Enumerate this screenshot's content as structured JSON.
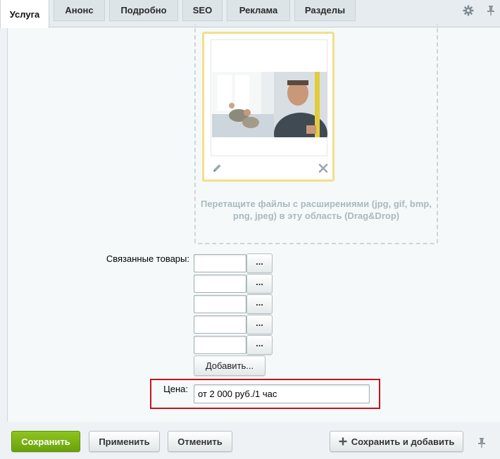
{
  "tabs": [
    {
      "label": "Услуга",
      "active": true
    },
    {
      "label": "Анонс",
      "active": false
    },
    {
      "label": "Подробно",
      "active": false
    },
    {
      "label": "SEO",
      "active": false
    },
    {
      "label": "Реклама",
      "active": false
    },
    {
      "label": "Разделы",
      "active": false
    }
  ],
  "toolbar_icons": [
    "gear-icon",
    "pin-icon"
  ],
  "image_upload": {
    "drop_hint": "Перетащите файлы с расширениями (jpg, gif, bmp, png, jpeg) в эту область (Drag&Drop)",
    "card_icons": [
      "pencil-icon",
      "close-icon"
    ]
  },
  "related_products": {
    "label": "Связанные товары:",
    "inputs": [
      "",
      "",
      "",
      "",
      ""
    ],
    "browse_label": "...",
    "add_label": "Добавить..."
  },
  "price": {
    "label": "Цена:",
    "value": "от 2 000 руб./1 час"
  },
  "footer": {
    "save": "Сохранить",
    "apply": "Применить",
    "cancel": "Отменить",
    "save_and_add": "Сохранить и добавить",
    "save_and_add_icon": "plus-icon",
    "pin_icon": "pin-icon"
  },
  "colors": {
    "accent_green": "#7cb814",
    "highlight_red": "#c0151f",
    "card_border": "#f2e08a"
  }
}
